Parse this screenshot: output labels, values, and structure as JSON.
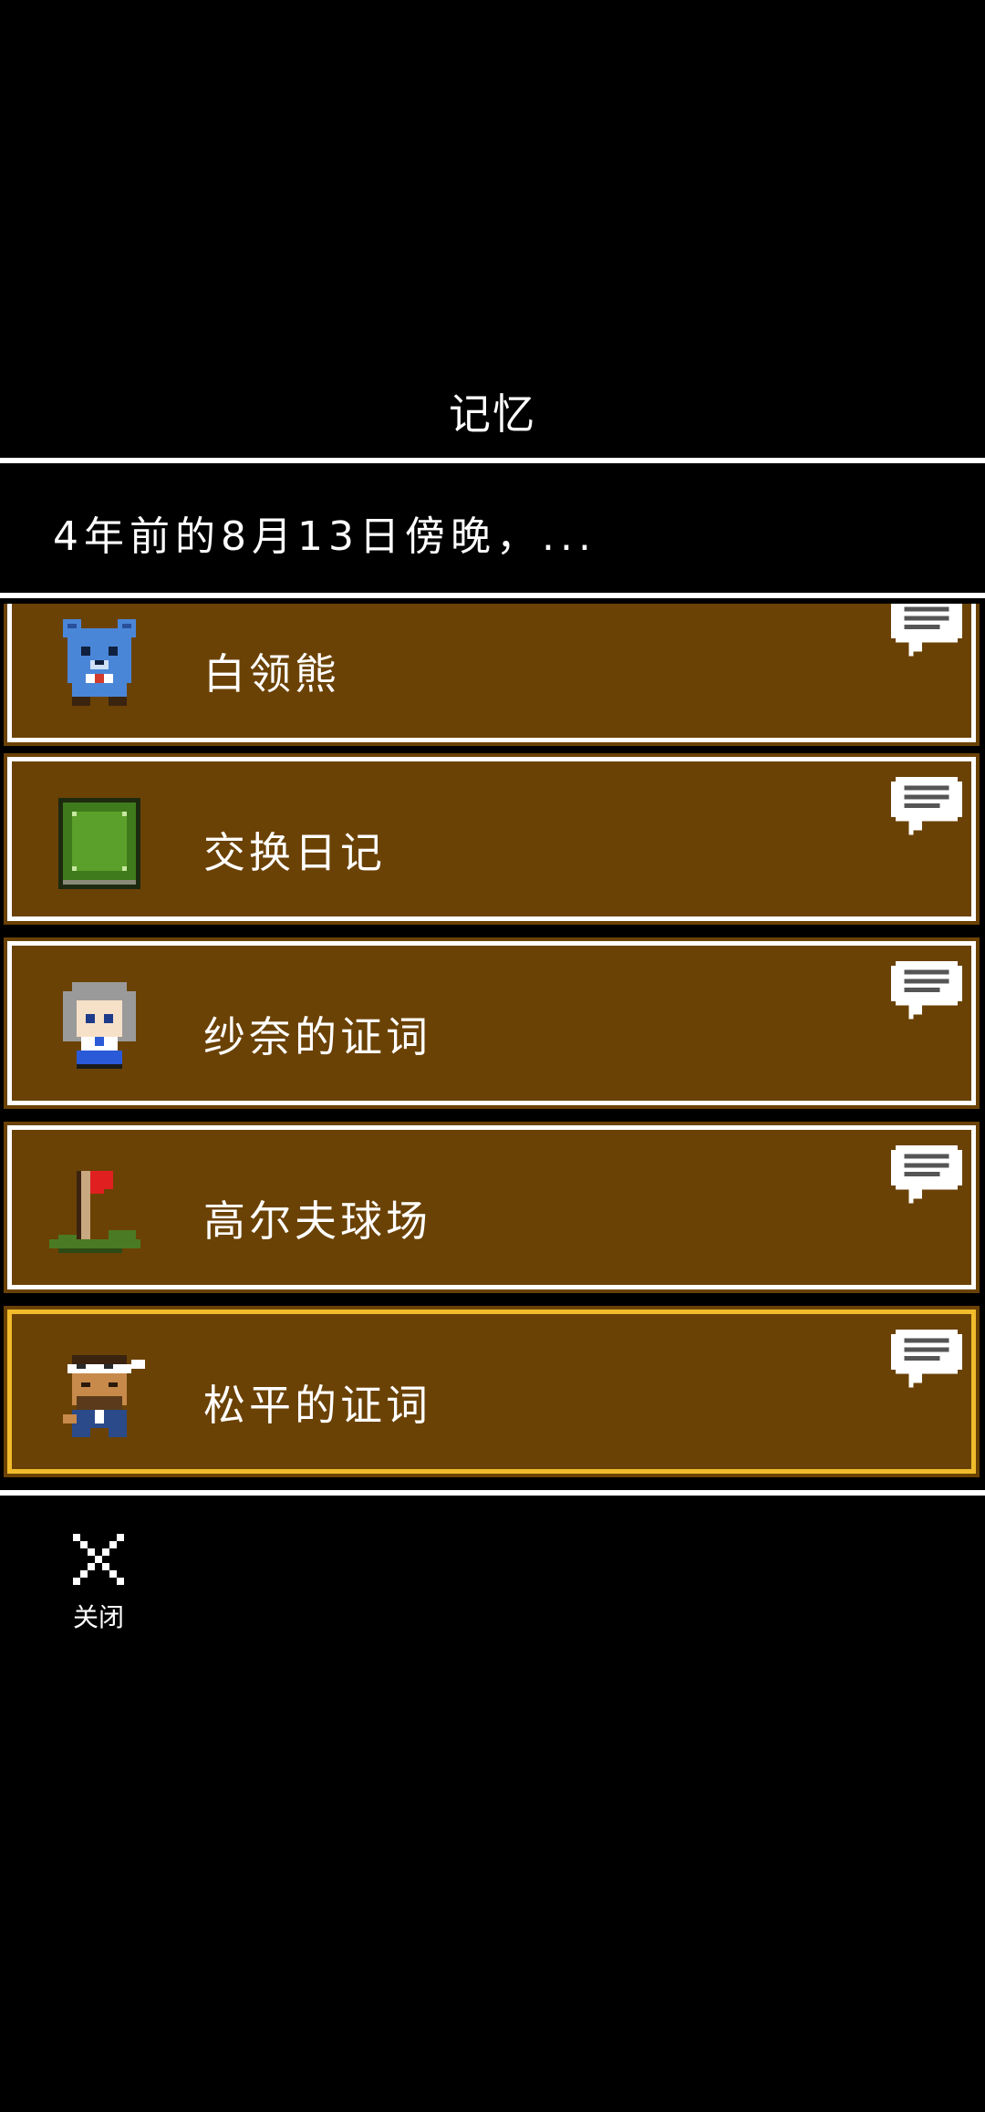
{
  "header": {
    "title": "记忆",
    "subtitle": "4年前的8月13日傍晚，..."
  },
  "memories": [
    {
      "label": "白领熊",
      "icon": "blue-bear-icon",
      "selected": false
    },
    {
      "label": "交换日记",
      "icon": "green-diary-icon",
      "selected": false
    },
    {
      "label": "纱奈的证词",
      "icon": "girl-portrait-icon",
      "selected": false
    },
    {
      "label": "高尔夫球场",
      "icon": "golf-flag-icon",
      "selected": false
    },
    {
      "label": "松平的证词",
      "icon": "man-portrait-icon",
      "selected": true
    }
  ],
  "footer": {
    "close_label": "关闭",
    "close_icon": "close-x-icon"
  },
  "colors": {
    "background": "#000000",
    "row_fill": "#6b4205",
    "row_border": "#ffffff",
    "selected_border": "#f0bc2c",
    "text": "#ffffff"
  }
}
